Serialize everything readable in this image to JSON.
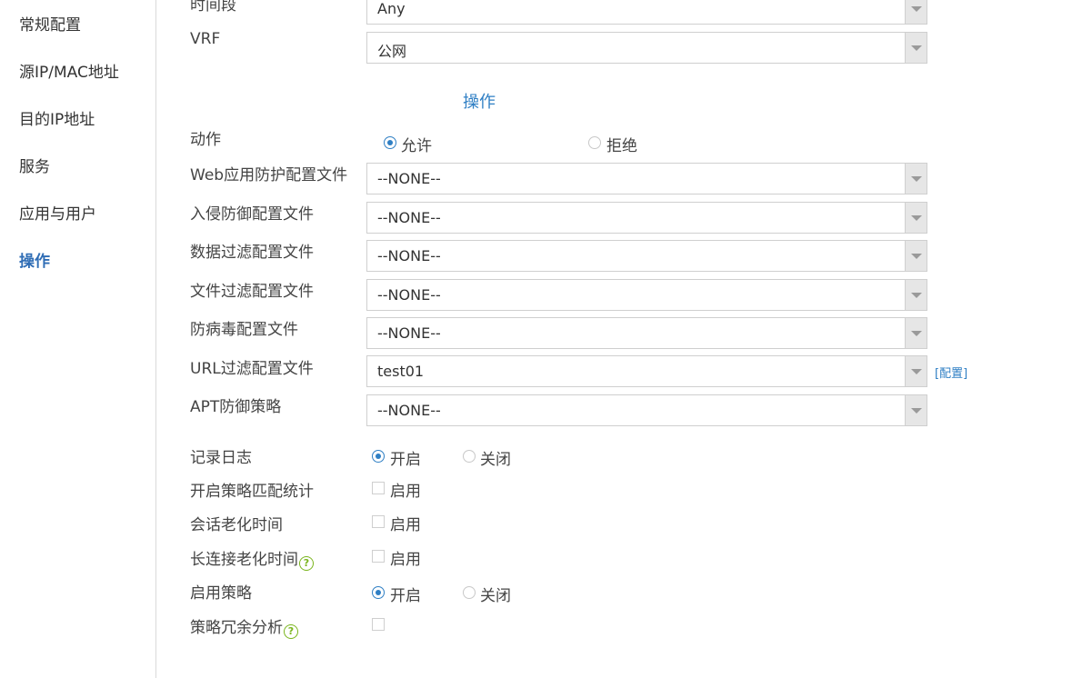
{
  "sidebar": {
    "items": [
      {
        "label": "常规配置"
      },
      {
        "label": "源IP/MAC地址"
      },
      {
        "label": "目的IP地址"
      },
      {
        "label": "服务"
      },
      {
        "label": "应用与用户"
      },
      {
        "label": "操作"
      }
    ]
  },
  "form": {
    "time_range": {
      "label": "时间段",
      "value": "Any"
    },
    "vrf": {
      "label": "VRF",
      "value": "公网"
    },
    "section_title": "操作",
    "action": {
      "label": "动作",
      "options": [
        "允许",
        "拒绝"
      ],
      "selected": "允许"
    },
    "profiles": [
      {
        "label": "Web应用防护配置文件",
        "value": "--NONE--"
      },
      {
        "label": "入侵防御配置文件",
        "value": "--NONE--"
      },
      {
        "label": "数据过滤配置文件",
        "value": "--NONE--"
      },
      {
        "label": "文件过滤配置文件",
        "value": "--NONE--"
      },
      {
        "label": "防病毒配置文件",
        "value": "--NONE--"
      },
      {
        "label": "URL过滤配置文件",
        "value": "test01",
        "link": "[配置]"
      },
      {
        "label": "APT防御策略",
        "value": "--NONE--"
      }
    ],
    "log": {
      "label": "记录日志",
      "options": [
        "开启",
        "关闭"
      ],
      "selected": "开启"
    },
    "match_stats": {
      "label": "开启策略匹配统计",
      "checkbox_label": "启用",
      "checked": false
    },
    "session_aging": {
      "label": "会话老化时间",
      "checkbox_label": "启用",
      "checked": false
    },
    "long_conn_aging": {
      "label": "长连接老化时间",
      "help": "?",
      "checkbox_label": "启用",
      "checked": false
    },
    "enable_policy": {
      "label": "启用策略",
      "options": [
        "开启",
        "关闭"
      ],
      "selected": "开启"
    },
    "redundancy": {
      "label": "策略冗余分析",
      "help": "?",
      "checked": false
    }
  },
  "colors": {
    "accent": "#2f7fc4",
    "help": "#7ab51d"
  }
}
